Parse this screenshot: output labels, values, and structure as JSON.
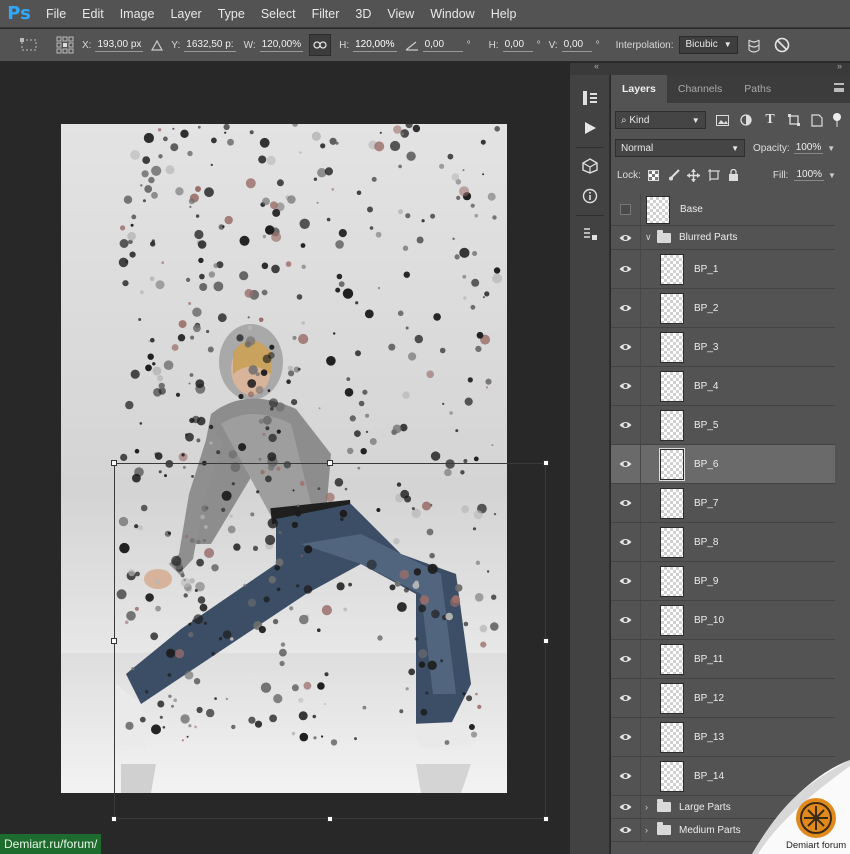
{
  "menu": {
    "logo": "Ps",
    "items": [
      "File",
      "Edit",
      "Image",
      "Layer",
      "Type",
      "Select",
      "Filter",
      "3D",
      "View",
      "Window",
      "Help"
    ]
  },
  "options": {
    "x_label": "X:",
    "x_value": "193,00 px",
    "y_label": "Y:",
    "y_value": "1632,50 p:",
    "w_label": "W:",
    "w_value": "120,00%",
    "h_label": "H:",
    "h_value": "120,00%",
    "angle_value": "0,00",
    "angle_unit": "°",
    "hskew_label": "H:",
    "hskew_value": "0,00",
    "hskew_unit": "°",
    "vskew_label": "V:",
    "vskew_value": "0,00",
    "vskew_unit": "°",
    "interp_label": "Interpolation:",
    "interp_value": "Bicubic"
  },
  "panel": {
    "tabs": [
      "Layers",
      "Channels",
      "Paths"
    ],
    "filter_kind": "Kind",
    "blend_mode": "Normal",
    "opacity_label": "Opacity:",
    "opacity_value": "100%",
    "lock_label": "Lock:",
    "fill_label": "Fill:",
    "fill_value": "100%"
  },
  "layers": {
    "base": "Base",
    "blurred_group": "Blurred Parts",
    "bp": [
      "BP_1",
      "BP_2",
      "BP_3",
      "BP_4",
      "BP_5",
      "BP_6",
      "BP_7",
      "BP_8",
      "BP_9",
      "BP_10",
      "BP_11",
      "BP_12",
      "BP_13",
      "BP_14"
    ],
    "selected": "BP_6",
    "large_group": "Large Parts",
    "medium_group": "Medium Parts"
  },
  "watermark": "Demiart.ru/forum/",
  "corner_logo_text": "Demiart forum",
  "colors": {
    "ps_blue": "#31a8ff",
    "panel": "#535353",
    "canvas_bg": "#282828"
  }
}
